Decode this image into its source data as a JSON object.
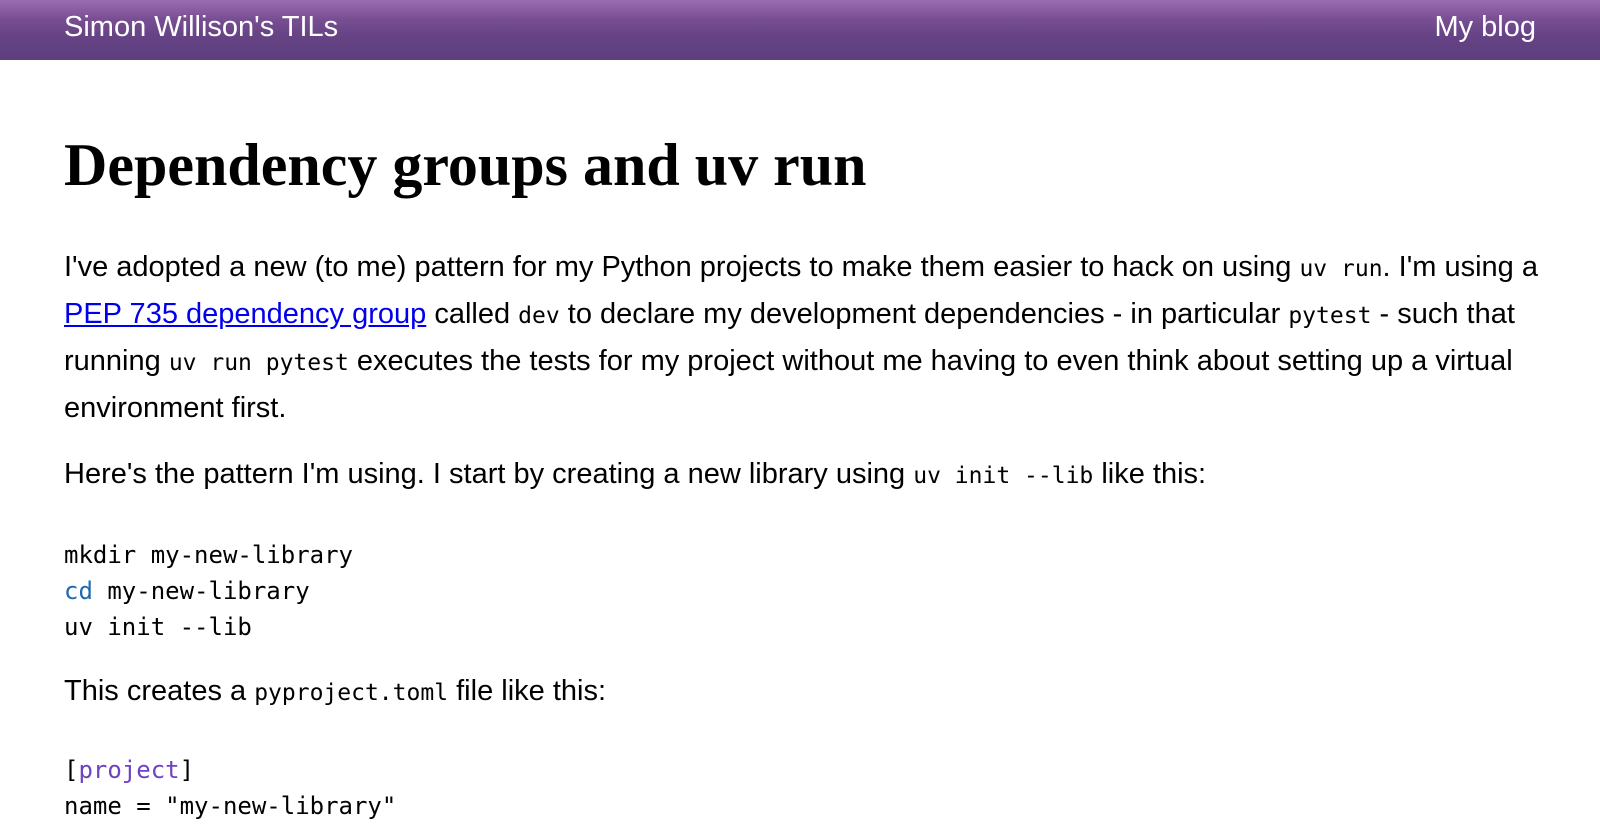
{
  "header": {
    "site_title": "Simon Willison's TILs",
    "blog_link": "My blog",
    "gradient_colors": [
      "#9a6cb0",
      "#5e3e7e"
    ]
  },
  "article": {
    "title": "Dependency groups and uv run",
    "p1": {
      "t1": "I've adopted a new (to me) pattern for my Python projects to make them easier to hack on using ",
      "c1": "uv run",
      "t2": ". I'm using a ",
      "link": "PEP 735 dependency group",
      "t3": " called ",
      "c2": "dev",
      "t4": " to declare my development dependencies - in particular ",
      "c3": "pytest",
      "t5": " - such that running ",
      "c4": "uv run pytest",
      "t6": " executes the tests for my project without me having to even think about setting up a virtual environment first."
    },
    "p2": {
      "t1": "Here's the pattern I'm using. I start by creating a new library using ",
      "c1": "uv init --lib",
      "t2": " like this:"
    },
    "code1": {
      "line1": "mkdir my-new-library",
      "line2_cmd": "cd",
      "line2_rest": " my-new-library",
      "line3": "uv init --lib"
    },
    "p3": {
      "t1": "This creates a ",
      "c1": "pyproject.toml",
      "t2": " file like this:"
    },
    "code2": {
      "open": "[",
      "section": "project",
      "close": "]",
      "partial": "name = \"my-new-library\""
    }
  },
  "colors": {
    "link": "#0000ee",
    "shell_keyword": "#1d6ab0",
    "toml_section": "#6f42c1"
  }
}
